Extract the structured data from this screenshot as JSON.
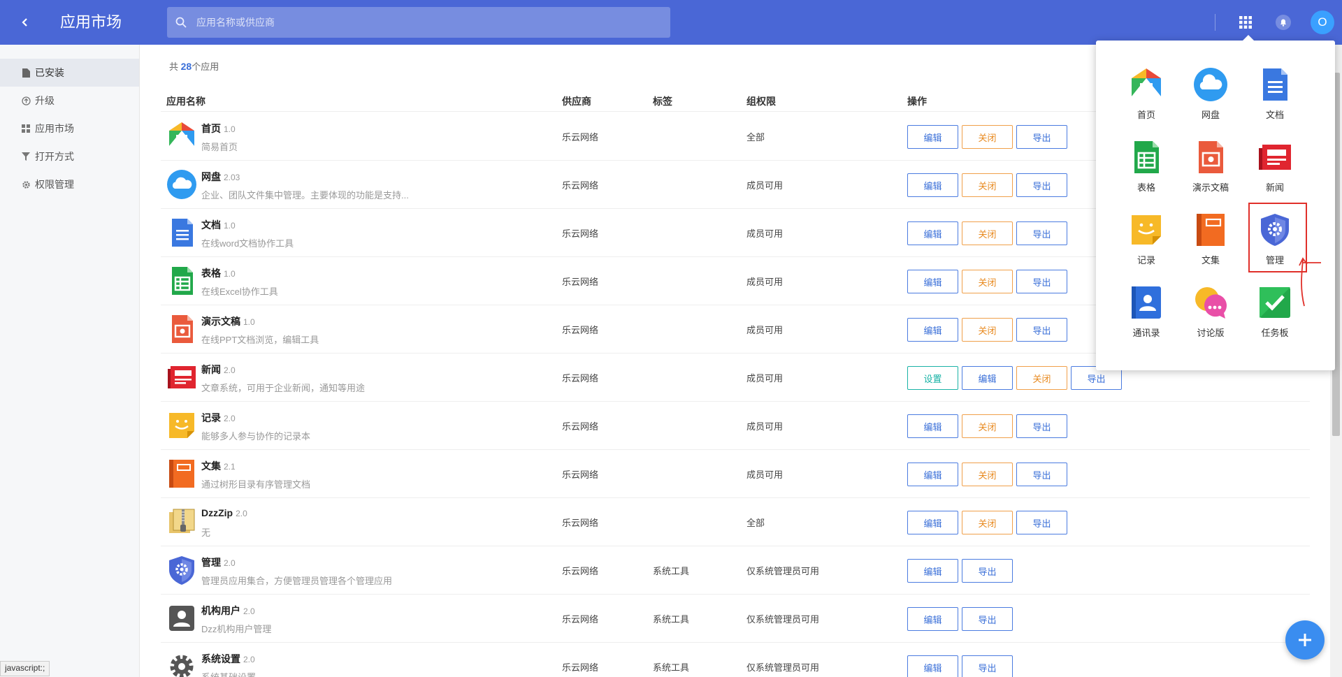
{
  "header": {
    "title": "应用市场",
    "search_placeholder": "应用名称或供应商",
    "avatar_letter": "O",
    "accent": "#4a67d6"
  },
  "sidebar": {
    "items": [
      {
        "label": "已安装",
        "icon": "file-icon",
        "active": true
      },
      {
        "label": "升级",
        "icon": "upgrade-icon"
      },
      {
        "label": "应用市场",
        "icon": "grid-icon"
      },
      {
        "label": "打开方式",
        "icon": "filter-icon"
      },
      {
        "label": "权限管理",
        "icon": "gear-icon"
      }
    ]
  },
  "summary": {
    "prefix": "共",
    "count": "28",
    "suffix": "个应用"
  },
  "table": {
    "headers": [
      "应用名称",
      "供应商",
      "标签",
      "组权限",
      "操作"
    ],
    "rows": [
      {
        "name": "首页",
        "version": "1.0",
        "desc": "简易首页",
        "vendor": "乐云网络",
        "tag": "",
        "perm": "全部",
        "ops": [
          "编辑",
          "关闭",
          "导出"
        ]
      },
      {
        "name": "网盘",
        "version": "2.03",
        "desc": "企业、团队文件集中管理。主要体现的功能是支持...",
        "vendor": "乐云网络",
        "tag": "",
        "perm": "成员可用",
        "ops": [
          "编辑",
          "关闭",
          "导出"
        ]
      },
      {
        "name": "文档",
        "version": "1.0",
        "desc": "在线word文档协作工具",
        "vendor": "乐云网络",
        "tag": "",
        "perm": "成员可用",
        "ops": [
          "编辑",
          "关闭",
          "导出"
        ]
      },
      {
        "name": "表格",
        "version": "1.0",
        "desc": "在线Excel协作工具",
        "vendor": "乐云网络",
        "tag": "",
        "perm": "成员可用",
        "ops": [
          "编辑",
          "关闭",
          "导出"
        ]
      },
      {
        "name": "演示文稿",
        "version": "1.0",
        "desc": "在线PPT文档浏览，编辑工具",
        "vendor": "乐云网络",
        "tag": "",
        "perm": "成员可用",
        "ops": [
          "编辑",
          "关闭",
          "导出"
        ]
      },
      {
        "name": "新闻",
        "version": "2.0",
        "desc": "文章系统，可用于企业新闻，通知等用途",
        "vendor": "乐云网络",
        "tag": "",
        "perm": "成员可用",
        "ops": [
          "设置",
          "编辑",
          "关闭",
          "导出"
        ]
      },
      {
        "name": "记录",
        "version": "2.0",
        "desc": "能够多人参与协作的记录本",
        "vendor": "乐云网络",
        "tag": "",
        "perm": "成员可用",
        "ops": [
          "编辑",
          "关闭",
          "导出"
        ]
      },
      {
        "name": "文集",
        "version": "2.1",
        "desc": "通过树形目录有序管理文档",
        "vendor": "乐云网络",
        "tag": "",
        "perm": "成员可用",
        "ops": [
          "编辑",
          "关闭",
          "导出"
        ]
      },
      {
        "name": "DzzZip",
        "version": "2.0",
        "desc": "无",
        "vendor": "乐云网络",
        "tag": "",
        "perm": "全部",
        "ops": [
          "编辑",
          "关闭",
          "导出"
        ]
      },
      {
        "name": "管理",
        "version": "2.0",
        "desc": "管理员应用集合，方便管理员管理各个管理应用",
        "vendor": "乐云网络",
        "tag": "系统工具",
        "perm": "仅系统管理员可用",
        "ops": [
          "编辑",
          "导出"
        ]
      },
      {
        "name": "机构用户",
        "version": "2.0",
        "desc": "Dzz机构用户管理",
        "vendor": "乐云网络",
        "tag": "系统工具",
        "perm": "仅系统管理员可用",
        "ops": [
          "编辑",
          "导出"
        ]
      },
      {
        "name": "系统设置",
        "version": "2.0",
        "desc": "系统基础设置",
        "vendor": "乐云网络",
        "tag": "系统工具",
        "perm": "仅系统管理员可用",
        "ops": [
          "编辑",
          "导出"
        ]
      }
    ]
  },
  "drawer": {
    "apps": [
      {
        "label": "首页",
        "icon": "home-app-icon"
      },
      {
        "label": "网盘",
        "icon": "cloud-app-icon"
      },
      {
        "label": "文档",
        "icon": "doc-app-icon"
      },
      {
        "label": "表格",
        "icon": "sheet-app-icon"
      },
      {
        "label": "演示文稿",
        "icon": "ppt-app-icon"
      },
      {
        "label": "新闻",
        "icon": "news-app-icon"
      },
      {
        "label": "记录",
        "icon": "note-app-icon"
      },
      {
        "label": "文集",
        "icon": "book-app-icon"
      },
      {
        "label": "管理",
        "icon": "admin-app-icon"
      },
      {
        "label": "通讯录",
        "icon": "contacts-app-icon"
      },
      {
        "label": "讨论版",
        "icon": "discuss-app-icon"
      },
      {
        "label": "任务板",
        "icon": "task-app-icon"
      }
    ]
  },
  "statusbar": {
    "text": "javascript:;"
  }
}
